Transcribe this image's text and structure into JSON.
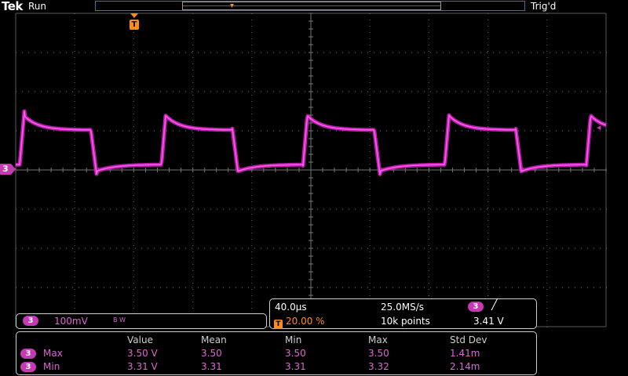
{
  "header": {
    "brand": "Tek",
    "acq_state": "Run",
    "trigger_status": "Trig'd"
  },
  "channel": {
    "number": "3",
    "marker_label": "3",
    "scale": "100mV",
    "bw_flag": "B W",
    "color": "#c43ab3"
  },
  "trigger": {
    "tag": "T",
    "position_percent": "20.00 %",
    "slope_icon": "rising-edge-icon",
    "level": "3.41 V"
  },
  "horizontal": {
    "time_div": "40.0µs",
    "sample_rate": "25.0MS/s",
    "record_length": "10k points"
  },
  "measurements": {
    "headers": [
      "Value",
      "Mean",
      "Min",
      "Max",
      "Std Dev"
    ],
    "rows": [
      {
        "channel": "3",
        "label": "Max",
        "value": "3.50 V",
        "mean": "3.50",
        "min": "3.50",
        "max": "3.50",
        "std": "1.41m"
      },
      {
        "channel": "3",
        "label": "Min",
        "value": "3.31 V",
        "mean": "3.31",
        "min": "3.31",
        "max": "3.32",
        "std": "2.14m"
      }
    ]
  },
  "waveform": {
    "description_values": {
      "period_divisions": 2.4,
      "high_level_divisions_above_ground": 1.1,
      "low_level_divisions_above_ground": 0.1
    }
  }
}
